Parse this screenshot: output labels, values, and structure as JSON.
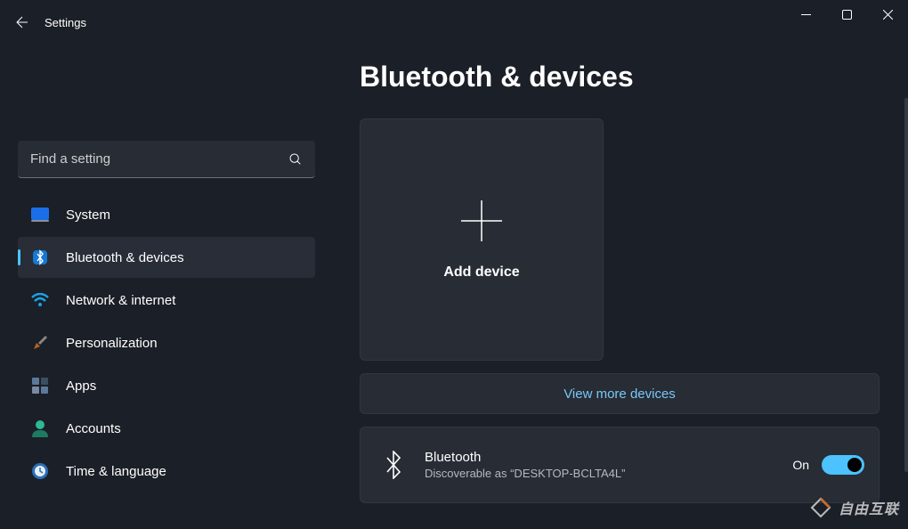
{
  "app_title": "Settings",
  "search": {
    "placeholder": "Find a setting"
  },
  "sidebar": {
    "items": [
      {
        "label": "System"
      },
      {
        "label": "Bluetooth & devices"
      },
      {
        "label": "Network & internet"
      },
      {
        "label": "Personalization"
      },
      {
        "label": "Apps"
      },
      {
        "label": "Accounts"
      },
      {
        "label": "Time & language"
      }
    ]
  },
  "page": {
    "title": "Bluetooth & devices",
    "add_device_label": "Add device",
    "view_more_label": "View more devices",
    "bluetooth_card": {
      "title": "Bluetooth",
      "subtitle": "Discoverable as “DESKTOP-BCLTA4L”",
      "state_label": "On",
      "state_on": true
    }
  },
  "watermark": "自由互联"
}
